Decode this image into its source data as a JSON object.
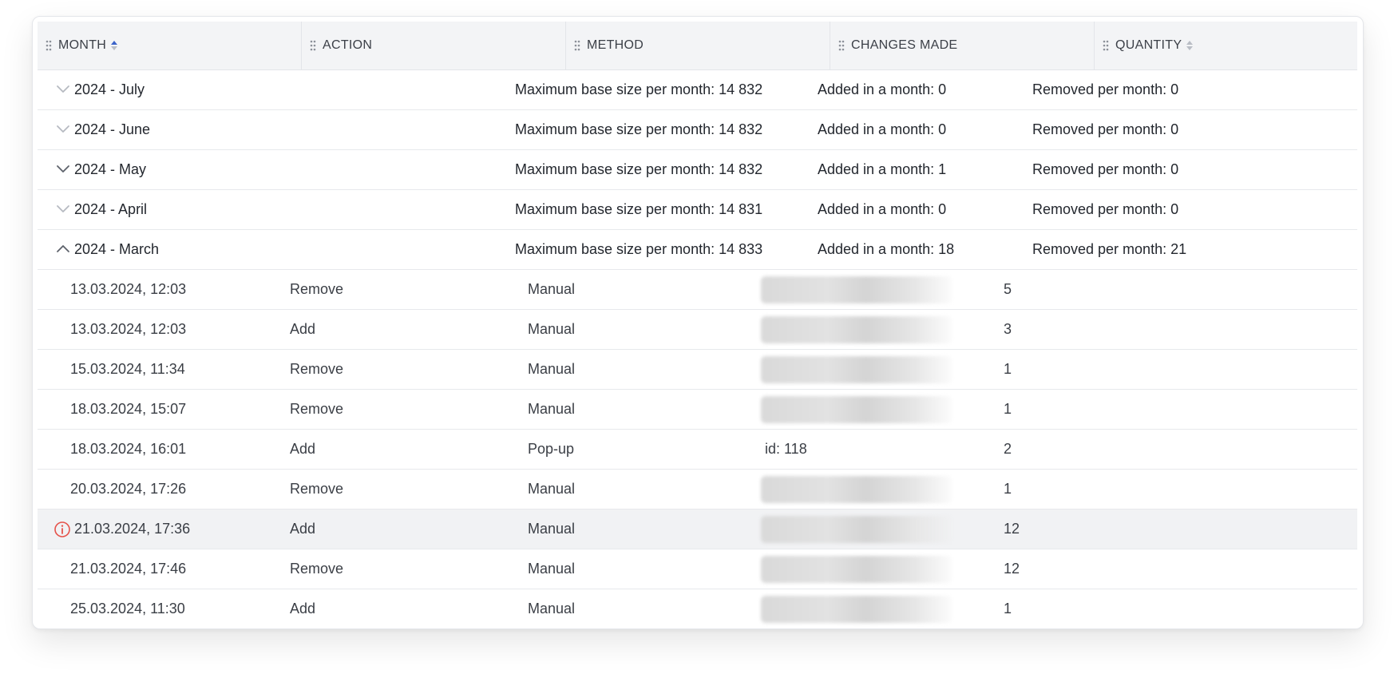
{
  "columns": [
    {
      "label": "MONTH",
      "sort": "asc"
    },
    {
      "label": "ACTION",
      "sort": "none"
    },
    {
      "label": "METHOD",
      "sort": "none"
    },
    {
      "label": "CHANGES MADE",
      "sort": "none"
    },
    {
      "label": "QUANTITY",
      "sort": "none"
    }
  ],
  "groups": [
    {
      "month": "2024 - July",
      "expanded": false,
      "chevron": "chevron-down-light-icon",
      "method": "Maximum base size per month: 14 832",
      "changes": "Added in a month: 0",
      "quantity": "Removed per month: 0"
    },
    {
      "month": "2024 - June",
      "expanded": false,
      "chevron": "chevron-down-light-icon",
      "method": "Maximum base size per month: 14 832",
      "changes": "Added in a month: 0",
      "quantity": "Removed per month: 0"
    },
    {
      "month": "2024 - May",
      "expanded": false,
      "chevron": "chevron-down-icon",
      "method": "Maximum base size per month: 14 832",
      "changes": "Added in a month: 1",
      "quantity": "Removed per month: 0"
    },
    {
      "month": "2024 - April",
      "expanded": false,
      "chevron": "chevron-down-light-icon",
      "method": "Maximum base size per month: 14 831",
      "changes": "Added in a month: 0",
      "quantity": "Removed per month: 0"
    },
    {
      "month": "2024 - March",
      "expanded": true,
      "chevron": "chevron-up-icon",
      "method": "Maximum base size per month: 14 833",
      "changes": "Added in a month: 18",
      "quantity": "Removed per month: 21"
    }
  ],
  "rows": [
    {
      "date": "13.03.2024, 12:03",
      "action": "Remove",
      "method": "Manual",
      "changes": "",
      "changes_redacted": true,
      "quantity": "5"
    },
    {
      "date": "13.03.2024, 12:03",
      "action": "Add",
      "method": "Manual",
      "changes": "",
      "changes_redacted": true,
      "quantity": "3"
    },
    {
      "date": "15.03.2024, 11:34",
      "action": "Remove",
      "method": "Manual",
      "changes": "",
      "changes_redacted": true,
      "quantity": "1"
    },
    {
      "date": "18.03.2024, 15:07",
      "action": "Remove",
      "method": "Manual",
      "changes": "",
      "changes_redacted": true,
      "quantity": "1"
    },
    {
      "date": "18.03.2024, 16:01",
      "action": "Add",
      "method": "Pop-up",
      "changes": "id: 118",
      "changes_redacted": false,
      "quantity": "2"
    },
    {
      "date": "20.03.2024, 17:26",
      "action": "Remove",
      "method": "Manual",
      "changes": "",
      "changes_redacted": true,
      "quantity": "1"
    },
    {
      "date": "21.03.2024, 17:36",
      "action": "Add",
      "method": "Manual",
      "changes": "",
      "changes_redacted": true,
      "quantity": "12",
      "warning": true,
      "warning_icon": "info-circle-icon"
    },
    {
      "date": "21.03.2024, 17:46",
      "action": "Remove",
      "method": "Manual",
      "changes": "",
      "changes_redacted": true,
      "quantity": "12"
    },
    {
      "date": "25.03.2024, 11:30",
      "action": "Add",
      "method": "Manual",
      "changes": "",
      "changes_redacted": true,
      "quantity": "1"
    }
  ],
  "colors": {
    "sort_active": "#3b63c9",
    "sort_inactive": "#b9bdc5",
    "warning": "#e5534b",
    "header_bg": "#f3f4f6",
    "highlight_row": "#f1f2f4"
  }
}
